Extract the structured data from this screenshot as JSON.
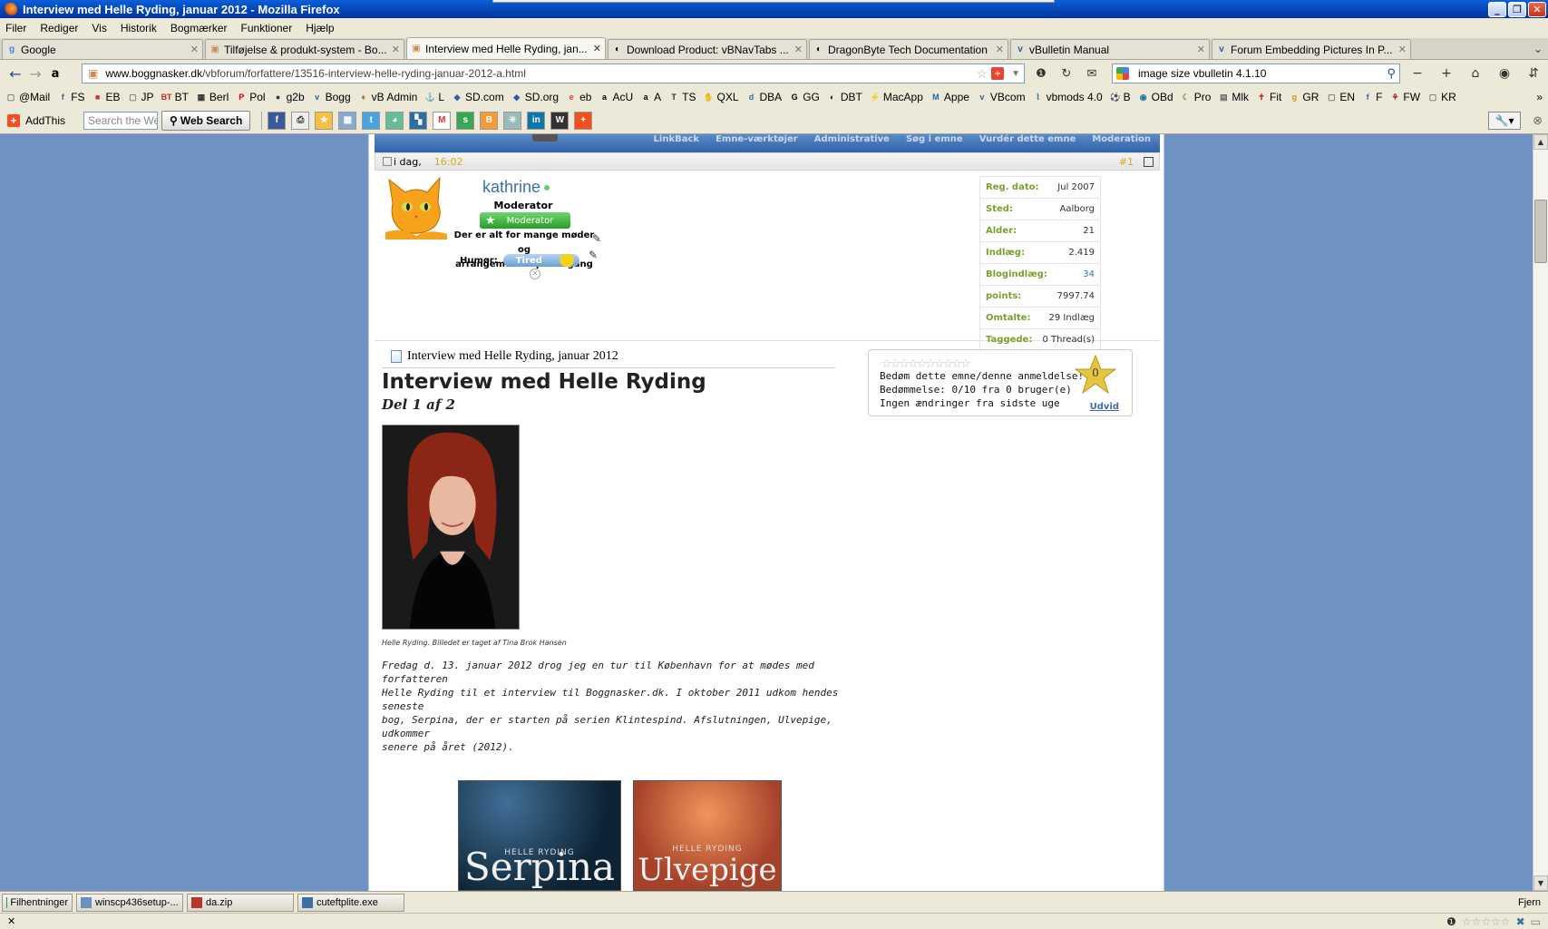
{
  "window": {
    "title": "Interview med Helle Ryding, januar 2012 - Mozilla Firefox"
  },
  "menu": [
    "Filer",
    "Rediger",
    "Vis",
    "Historik",
    "Bogmærker",
    "Funktioner",
    "Hjælp"
  ],
  "tabs": [
    {
      "label": "Google",
      "icon": "google-icon",
      "active": false
    },
    {
      "label": "Tilføjelse & produkt-system - Bo...",
      "icon": "page-icon",
      "active": false
    },
    {
      "label": "Interview med Helle Ryding, jan...",
      "icon": "page-icon",
      "active": true
    },
    {
      "label": "Download Product: vBNavTabs ...",
      "icon": "dragonbyte-icon",
      "active": false
    },
    {
      "label": "DragonByte Tech Documentation",
      "icon": "dragonbyte-icon",
      "active": false
    },
    {
      "label": "vBulletin Manual",
      "icon": "vbulletin-icon",
      "active": false
    },
    {
      "label": "Forum Embedding Pictures In P...",
      "icon": "vbulletin-icon",
      "active": false
    }
  ],
  "address": {
    "domain": "www.boggnasker.dk",
    "path": "/vbforum/forfattere/13516-interview-helle-ryding-januar-2012-a.html"
  },
  "search": {
    "value": "image size vbulletin 4.1.10"
  },
  "bookmarks": [
    {
      "label": "@Mail",
      "icon": "folder-icon"
    },
    {
      "label": "FS",
      "icon": "facebook-icon"
    },
    {
      "label": "EB",
      "icon": "eb-icon"
    },
    {
      "label": "JP",
      "icon": "folder-icon"
    },
    {
      "label": "BT",
      "icon": "bt-icon"
    },
    {
      "label": "Berl",
      "icon": "berlingske-icon"
    },
    {
      "label": "Pol",
      "icon": "politiken-icon"
    },
    {
      "label": "g2b",
      "icon": "g2b-icon"
    },
    {
      "label": "Bogg",
      "icon": "vbulletin-icon"
    },
    {
      "label": "vB Admin",
      "icon": "admin-icon"
    },
    {
      "label": "L",
      "icon": "link-icon"
    },
    {
      "label": "SD.com",
      "icon": "sd-icon"
    },
    {
      "label": "SD.org",
      "icon": "sd-icon"
    },
    {
      "label": "eb",
      "icon": "ebay-icon"
    },
    {
      "label": "AcU",
      "icon": "amazon-icon"
    },
    {
      "label": "A",
      "icon": "amazon-icon"
    },
    {
      "label": "TS",
      "icon": "ts-icon"
    },
    {
      "label": "QXL",
      "icon": "qxl-icon"
    },
    {
      "label": "DBA",
      "icon": "dba-icon"
    },
    {
      "label": "GG",
      "icon": "gg-icon"
    },
    {
      "label": "DBT",
      "icon": "dragonbyte-icon"
    },
    {
      "label": "MacApp",
      "icon": "macapp-icon"
    },
    {
      "label": "Appe",
      "icon": "m-icon"
    },
    {
      "label": "VBcom",
      "icon": "vbulletin-icon"
    },
    {
      "label": "vbmods 4.0",
      "icon": "vbmods-icon"
    },
    {
      "label": "B",
      "icon": "soccer-icon"
    },
    {
      "label": "OBd",
      "icon": "obd-icon"
    },
    {
      "label": "Pro",
      "icon": "pro-icon"
    },
    {
      "label": "Mlk",
      "icon": "mlk-icon"
    },
    {
      "label": "Fit",
      "icon": "fit-icon"
    },
    {
      "label": "GR",
      "icon": "gr-icon"
    },
    {
      "label": "EN",
      "icon": "folder-icon"
    },
    {
      "label": "F",
      "icon": "f-icon"
    },
    {
      "label": "FW",
      "icon": "fw-icon"
    },
    {
      "label": "KR",
      "icon": "folder-icon"
    }
  ],
  "addthis": {
    "label": "AddThis",
    "search_placeholder": "Search the Web",
    "search_button": "Web Search"
  },
  "post": {
    "date_label": "i dag,",
    "time": "16:02",
    "number": "#1",
    "forum_nav": [
      "LinkBack",
      "Emne-værktøjer",
      "Administrative",
      "Søg i emne",
      "Vurdér dette emne",
      "Moderation"
    ]
  },
  "user": {
    "name": "kathrine",
    "title": "Moderator",
    "badge": "Moderator",
    "status_line1": "Der er alt for mange møder og",
    "status_line2": "arrangementer på en gang",
    "mood_label": "Humør:",
    "mood_value": "Tired"
  },
  "stats": [
    {
      "label": "Reg. dato:",
      "value": "Jul 2007"
    },
    {
      "label": "Sted:",
      "value": "Aalborg"
    },
    {
      "label": "Alder:",
      "value": "21"
    },
    {
      "label": "Indlæg:",
      "value": "2.419"
    },
    {
      "label": "Blogindlæg:",
      "value": "34"
    },
    {
      "label": "points:",
      "value": "7997.74"
    },
    {
      "label": "Omtalte:",
      "value": "29 Indlæg"
    },
    {
      "label": "Taggede:",
      "value": "0 Thread(s)"
    }
  ],
  "article": {
    "thread_title": "Interview med Helle Ryding, januar 2012",
    "heading": "Interview med Helle Ryding",
    "subheading": "Del 1 af 2",
    "caption": "Helle Ryding. Billedet er taget af Tina Brok Hansen",
    "body_lines": [
      "Fredag d. 13. januar 2012 drog jeg en tur til København for at mødes med forfatteren",
      "Helle Ryding til et interview til Boggnasker.dk. I oktober 2011 udkom hendes seneste",
      "bog, Serpina, der er starten på serien Klintespind. Afslutningen, Ulvepige, udkommer",
      "senere på året (2012)."
    ],
    "covers": [
      {
        "title": "Serpina",
        "author": "HELLE RYDING"
      },
      {
        "title": "Ulvepige",
        "author": "HELLE RYDING"
      }
    ]
  },
  "rating": {
    "line1": "Bedøm dette emne/denne anmeldelse!",
    "line2": "Bedømmelse: 0/10 fra 0 bruger(e)",
    "line3": "Ingen ændringer fra sidste uge",
    "score": "0",
    "expand": "Udvid"
  },
  "downloads": [
    {
      "label": "Filhentninger",
      "icon": "downloads-icon"
    },
    {
      "label": "winscp436setup-...",
      "icon": "installer-icon"
    },
    {
      "label": "da.zip",
      "icon": "zip-icon"
    },
    {
      "label": "cuteftplite.exe",
      "icon": "exe-icon"
    }
  ],
  "downloads_remove": "Fjern",
  "colors": {
    "page_bg": "#6e93c2",
    "title_bar": "#0443b4",
    "accent_green": "#79a02c",
    "link_blue": "#3a6fb0",
    "time_orange": "#e3a516"
  }
}
